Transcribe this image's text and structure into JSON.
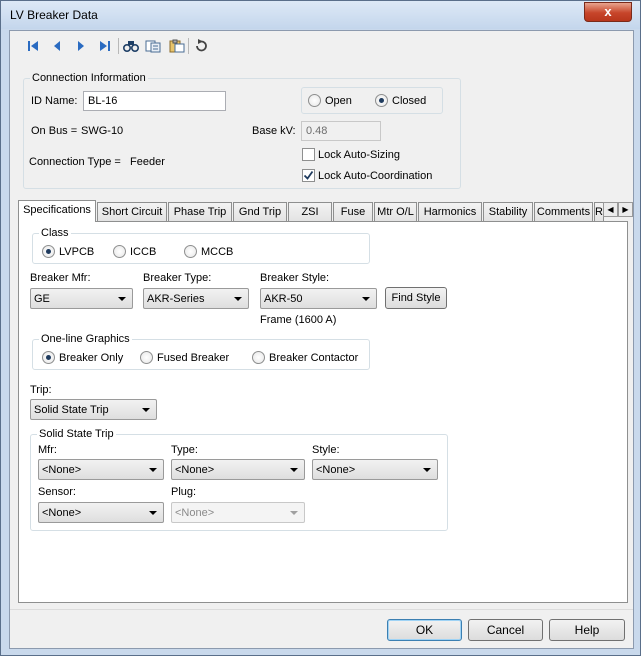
{
  "window": {
    "title": "LV Breaker Data",
    "close_glyph": "x"
  },
  "toolbar": {
    "buttons": [
      {
        "name": "first-record-icon"
      },
      {
        "name": "previous-record-icon"
      },
      {
        "name": "next-record-icon"
      },
      {
        "name": "last-record-icon"
      },
      {
        "name": "find-icon"
      },
      {
        "name": "copy-icon"
      },
      {
        "name": "paste-icon"
      },
      {
        "name": "undo-icon"
      }
    ]
  },
  "connection": {
    "title": "Connection Information",
    "id_label": "ID Name:",
    "id_value": "BL-16",
    "bus_label": "On Bus =",
    "bus_value": "SWG-10",
    "type_label": "Connection Type =",
    "type_value": "Feeder",
    "state_open": "Open",
    "state_closed": "Closed",
    "basekv_label": "Base kV:",
    "basekv_value": "0.48",
    "lock_sizing": "Lock Auto-Sizing",
    "lock_coord": "Lock Auto-Coordination"
  },
  "tabs": [
    "Specifications",
    "Short Circuit",
    "Phase Trip",
    "Gnd Trip",
    "ZSI",
    "Fuse",
    "Mtr O/L",
    "Harmonics",
    "Stability",
    "Comments",
    "R"
  ],
  "tab_scroll": {
    "left": "◀",
    "right": "▶"
  },
  "specs": {
    "class_title": "Class",
    "class_lvpcb": "LVPCB",
    "class_iccb": "ICCB",
    "class_mccb": "MCCB",
    "mfr_label": "Breaker Mfr:",
    "mfr_value": "GE",
    "type_label": "Breaker Type:",
    "type_value": "AKR-Series",
    "style_label": "Breaker Style:",
    "style_value": "AKR-50",
    "find_style": "Find Style",
    "frame": "Frame (1600 A)",
    "oneline_title": "One-line Graphics",
    "ol_breaker_only": "Breaker Only",
    "ol_fused": "Fused Breaker",
    "ol_contactor": "Breaker Contactor",
    "trip_label": "Trip:",
    "trip_value": "Solid State Trip",
    "sst_title": "Solid State Trip",
    "sst_mfr_label": "Mfr:",
    "sst_mfr_value": "<None>",
    "sst_type_label": "Type:",
    "sst_type_value": "<None>",
    "sst_style_label": "Style:",
    "sst_style_value": "<None>",
    "sst_sensor_label": "Sensor:",
    "sst_sensor_value": "<None>",
    "sst_plug_label": "Plug:",
    "sst_plug_value": "<None>"
  },
  "buttons": {
    "ok": "OK",
    "cancel": "Cancel",
    "help": "Help"
  },
  "colors": {
    "accent": "#2a6bc1",
    "close": "#c7452a"
  }
}
